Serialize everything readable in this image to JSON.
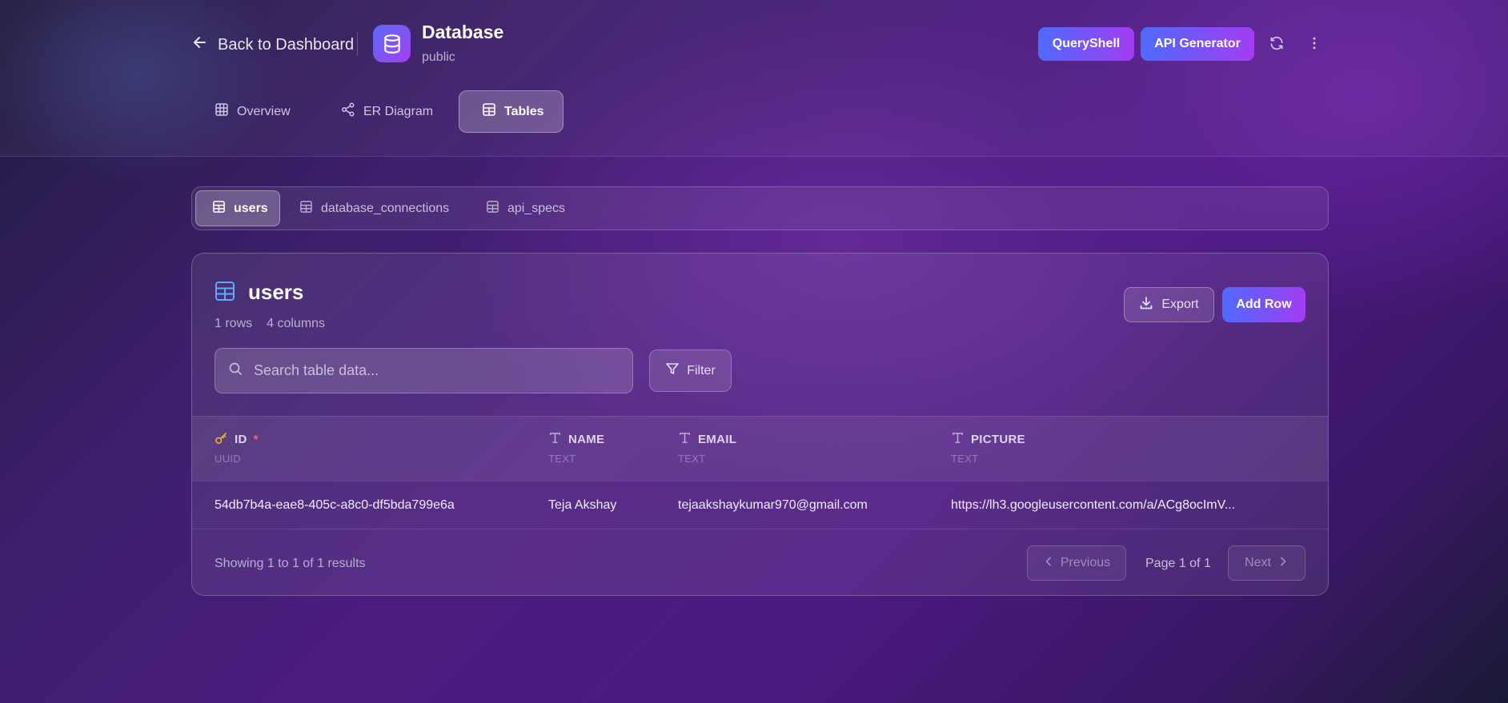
{
  "header": {
    "back_label": "Back to Dashboard",
    "db_title": "Database",
    "db_schema": "public",
    "queryshell_label": "QueryShell",
    "api_generator_label": "API Generator"
  },
  "nav_tabs": [
    {
      "label": "Overview",
      "icon": "grid-icon",
      "active": false
    },
    {
      "label": "ER Diagram",
      "icon": "share-icon",
      "active": false
    },
    {
      "label": "Tables",
      "icon": "table-icon",
      "active": true
    }
  ],
  "table_tabs": [
    {
      "label": "users",
      "active": true
    },
    {
      "label": "database_connections",
      "active": false
    },
    {
      "label": "api_specs",
      "active": false
    }
  ],
  "table_card": {
    "title": "users",
    "rows_text": "1 rows",
    "columns_text": "4 columns",
    "export_label": "Export",
    "add_row_label": "Add Row",
    "search_placeholder": "Search table data...",
    "filter_label": "Filter"
  },
  "columns": [
    {
      "name": "ID",
      "type": "UUID",
      "icon": "key-icon",
      "required_mark": "*"
    },
    {
      "name": "NAME",
      "type": "TEXT",
      "icon": "text-type-icon"
    },
    {
      "name": "EMAIL",
      "type": "TEXT",
      "icon": "text-type-icon"
    },
    {
      "name": "PICTURE",
      "type": "TEXT",
      "icon": "text-type-icon"
    }
  ],
  "rows": [
    {
      "id": "54db7b4a-eae8-405c-a8c0-df5bda799e6a",
      "name": "Teja Akshay",
      "email": "tejaakshaykumar970@gmail.com",
      "picture": "https://lh3.googleusercontent.com/a/ACg8ocImV..."
    }
  ],
  "pagination": {
    "summary": "Showing 1 to 1 of 1 results",
    "previous_label": "Previous",
    "page_label": "Page 1 of 1",
    "next_label": "Next"
  },
  "colors": {
    "accent_gradient_start": "#4e6bff",
    "accent_gradient_end": "#a33cf2",
    "key_icon": "#f5b820",
    "required_mark": "#ff5c7a",
    "table_icon_blue": "#5fa8ff"
  }
}
